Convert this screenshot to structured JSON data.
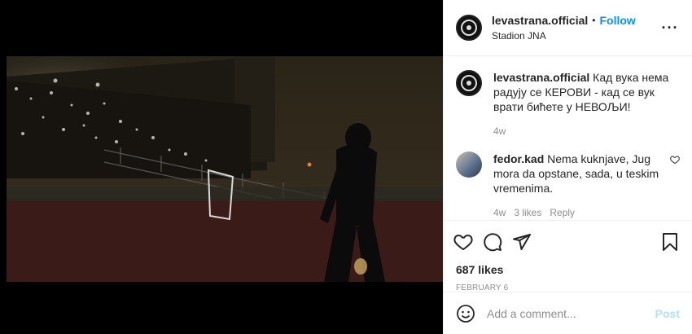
{
  "post": {
    "username": "levastrana.official",
    "separator": "•",
    "follow_label": "Follow",
    "location": "Stadion JNA",
    "more_glyph": "···"
  },
  "caption": {
    "username": "levastrana.official",
    "text": "Кад вука нема радују се КЕРОВИ - кад се вук врати бићете у НЕВОЉИ!",
    "age": "4w"
  },
  "comments": [
    {
      "username": "fedor.kad",
      "text": "Nema kuknjave, Jug mora da opstane, sada, u teskim vremenima.",
      "age": "4w",
      "likes": "3 likes",
      "reply_label": "Reply"
    }
  ],
  "stats": {
    "likes": "687 likes",
    "date": "FEBRUARY 6"
  },
  "composer": {
    "placeholder": "Add a comment...",
    "post_label": "Post"
  },
  "icons": {
    "like": "heart-icon",
    "comment": "comment-icon",
    "share": "share-icon",
    "save": "bookmark-icon",
    "emoji": "emoji-icon",
    "more": "more-options-icon"
  }
}
